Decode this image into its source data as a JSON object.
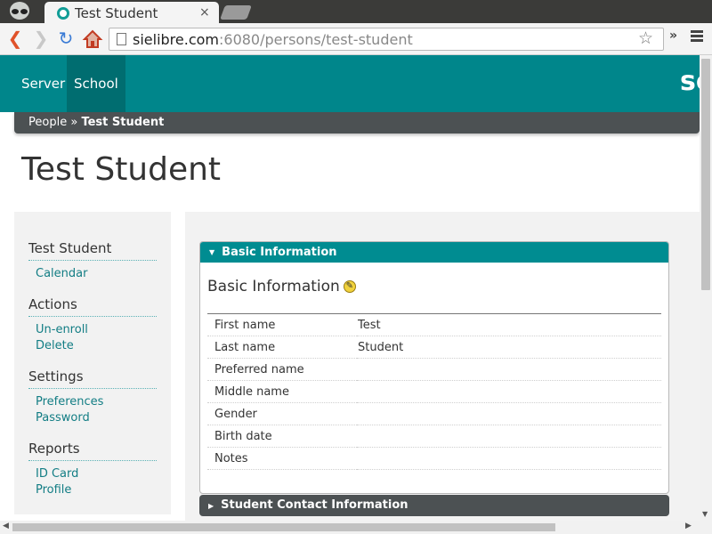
{
  "browser": {
    "tab_title": "Test Student",
    "tab_close": "×",
    "url_host": "sielibre.com",
    "url_rest": ":6080/persons/test-student",
    "extensions_label": "»"
  },
  "nav": {
    "items": [
      {
        "label": "Server"
      },
      {
        "label": "School"
      }
    ],
    "brand": "sc"
  },
  "breadcrumb": {
    "parent": "People",
    "separator": "»",
    "current": "Test Student"
  },
  "page": {
    "title": "Test Student"
  },
  "sidebar": {
    "groups": [
      {
        "heading": "Test Student",
        "links": [
          "Calendar"
        ]
      },
      {
        "heading": "Actions",
        "links": [
          "Un-enroll",
          "Delete"
        ]
      },
      {
        "heading": "Settings",
        "links": [
          "Preferences",
          "Password"
        ]
      },
      {
        "heading": "Reports",
        "links": [
          "ID Card",
          "Profile"
        ]
      }
    ]
  },
  "basic_info": {
    "panel_label": "Basic Information",
    "heading": "Basic Information",
    "rows": [
      {
        "label": "First name",
        "value": "Test"
      },
      {
        "label": "Last name",
        "value": "Student"
      },
      {
        "label": "Preferred name",
        "value": ""
      },
      {
        "label": "Middle name",
        "value": ""
      },
      {
        "label": "Gender",
        "value": ""
      },
      {
        "label": "Birth date",
        "value": ""
      },
      {
        "label": "Notes",
        "value": ""
      }
    ]
  },
  "contact_panel": {
    "label": "Student Contact Information"
  },
  "colors": {
    "navbar": "#00868b",
    "nav_active": "#006d70",
    "breadcrumb": "#4c5153",
    "link": "#127d84"
  }
}
